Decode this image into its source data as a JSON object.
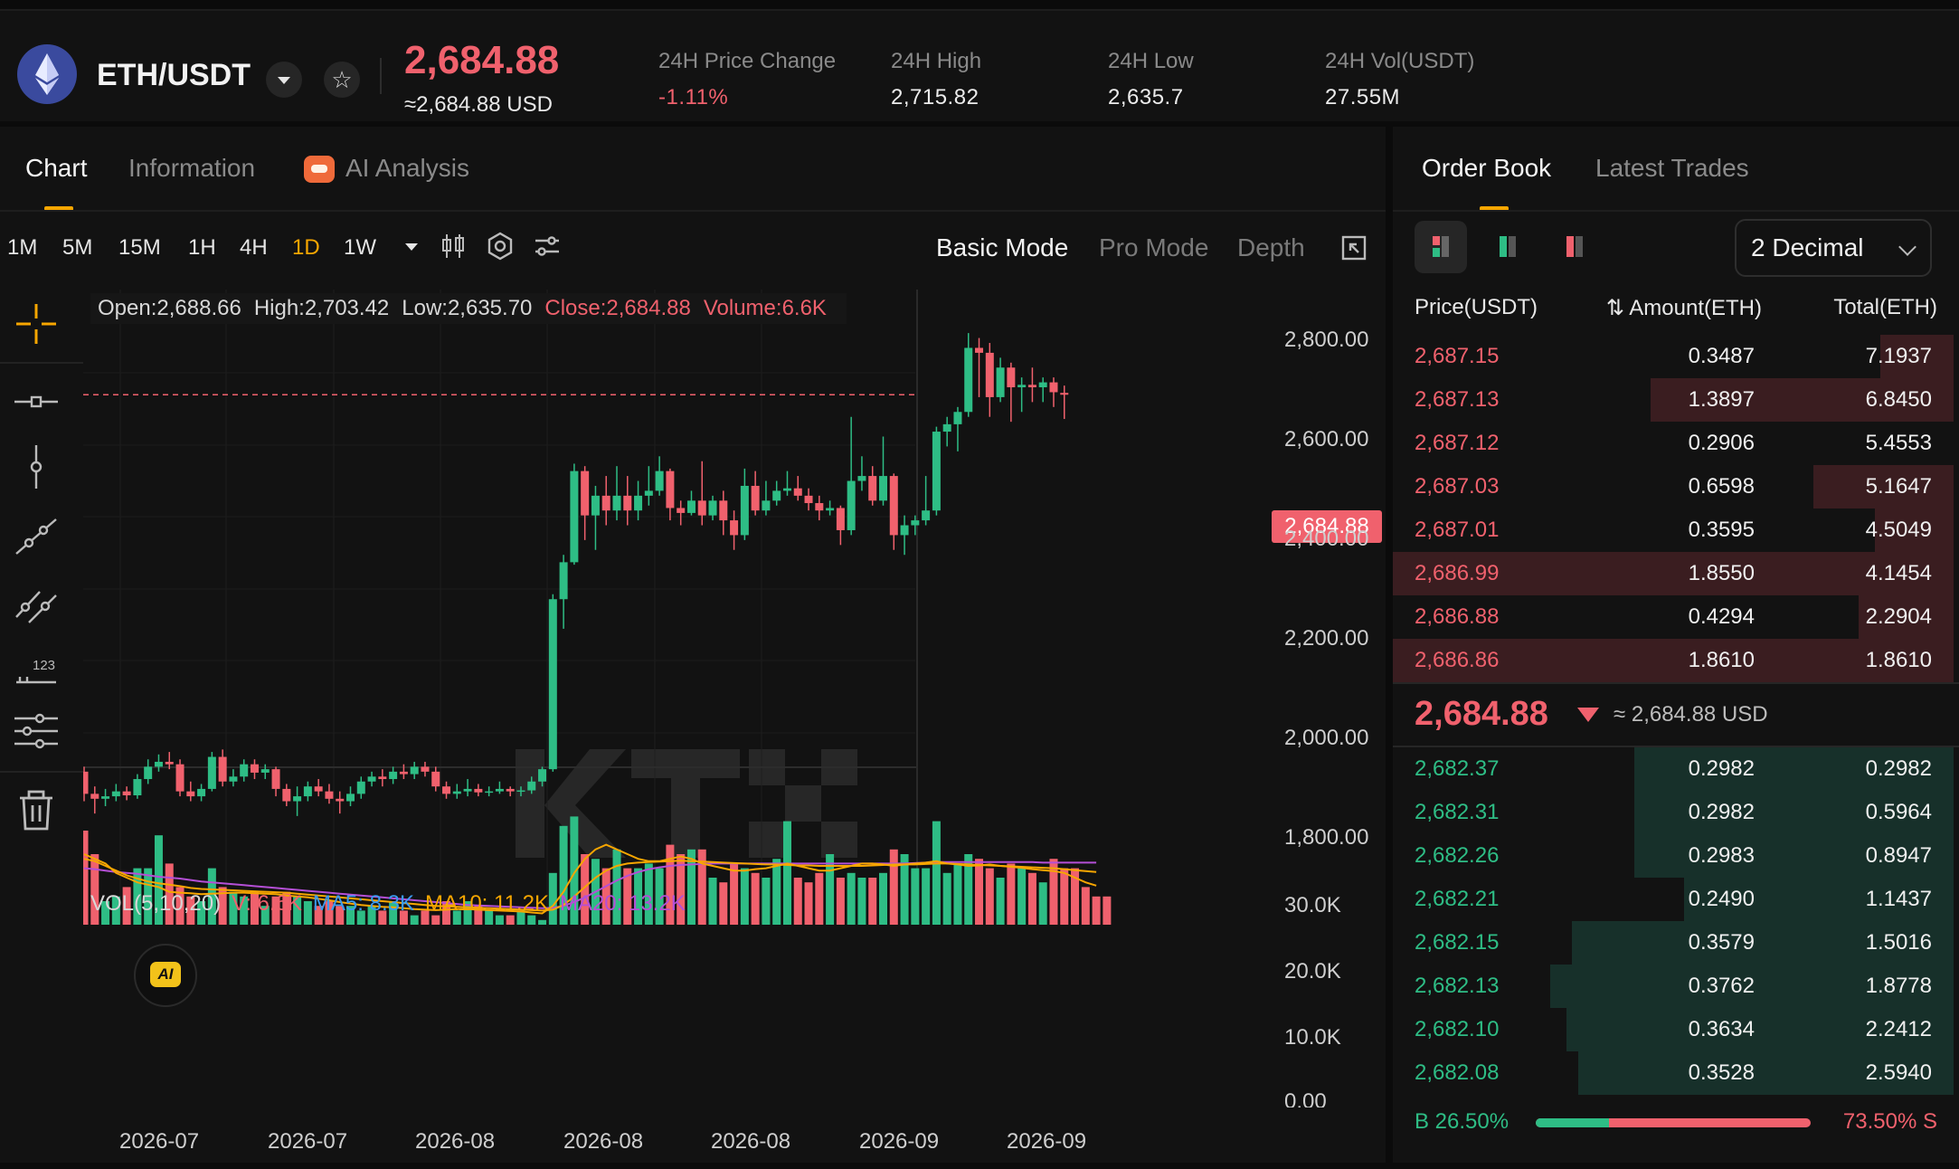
{
  "header": {
    "pair": "ETH/USDT",
    "last_price": "2,684.88",
    "last_price_usd": "≈2,684.88 USD",
    "stats": [
      {
        "label": "24H Price Change",
        "value": "-1.11%",
        "negative": true
      },
      {
        "label": "24H High",
        "value": "2,715.82"
      },
      {
        "label": "24H Low",
        "value": "2,635.7"
      },
      {
        "label": "24H Vol(USDT)",
        "value": "27.55M"
      }
    ]
  },
  "chart_tabs": [
    {
      "label": "Chart"
    },
    {
      "label": "Information"
    },
    {
      "label": "AI Analysis"
    }
  ],
  "intervals": [
    "1M",
    "5M",
    "15M",
    "1H",
    "4H",
    "1D",
    "1W"
  ],
  "active_interval": "1D",
  "modes": [
    "Basic Mode",
    "Pro Mode",
    "Depth"
  ],
  "ohlc": {
    "open": "Open:2,688.66",
    "high": "High:2,703.42",
    "low": "Low:2,635.70",
    "close": "Close:2,684.88",
    "volume": "Volume:6.6K"
  },
  "vol_legend": {
    "title": "VOL(5,10,20)",
    "v": "V: 6.6K",
    "ma5": "MA5: 8.3K",
    "ma10": "MA10: 11.2K",
    "ma20": "MA20: 13.2K"
  },
  "ai_badge": "AI",
  "current_price_tag": "2,684.88",
  "colors": {
    "up": "#2ebd85",
    "down": "#f0616d",
    "accent": "#f7a600",
    "ma5": "#f7a600",
    "ma10": "#f7a600",
    "ma20": "#b44fd6"
  },
  "chart_data": {
    "type": "candlestick",
    "price_axis": {
      "min": 1760,
      "max": 2880,
      "ticks": [
        "2,800.00",
        "2,600.00",
        "2,400.00",
        "2,200.00",
        "2,000.00",
        "1,800.00"
      ]
    },
    "volume_axis": {
      "min": 0,
      "max": 30000,
      "ticks": [
        "30.0K",
        "20.0K",
        "10.0K",
        "0.00"
      ]
    },
    "x_ticks": [
      "2026-07",
      "2026-07",
      "2026-08",
      "2026-08",
      "2026-08",
      "2026-09",
      "2026-09"
    ],
    "candles": [
      [
        1920,
        1875,
        1930,
        1860
      ],
      [
        1875,
        1865,
        1890,
        1835
      ],
      [
        1865,
        1870,
        1885,
        1850
      ],
      [
        1870,
        1880,
        1895,
        1860
      ],
      [
        1880,
        1872,
        1890,
        1862
      ],
      [
        1872,
        1905,
        1915,
        1865
      ],
      [
        1905,
        1930,
        1945,
        1895
      ],
      [
        1930,
        1940,
        1955,
        1920
      ],
      [
        1940,
        1935,
        1960,
        1925
      ],
      [
        1935,
        1880,
        1945,
        1870
      ],
      [
        1880,
        1870,
        1900,
        1860
      ],
      [
        1870,
        1885,
        1895,
        1860
      ],
      [
        1885,
        1950,
        1960,
        1880
      ],
      [
        1950,
        1900,
        1965,
        1890
      ],
      [
        1900,
        1910,
        1925,
        1890
      ],
      [
        1910,
        1935,
        1945,
        1900
      ],
      [
        1935,
        1918,
        1945,
        1905
      ],
      [
        1918,
        1925,
        1935,
        1905
      ],
      [
        1925,
        1885,
        1930,
        1870
      ],
      [
        1885,
        1860,
        1895,
        1850
      ],
      [
        1860,
        1870,
        1890,
        1830
      ],
      [
        1870,
        1890,
        1900,
        1860
      ],
      [
        1890,
        1880,
        1905,
        1870
      ],
      [
        1880,
        1865,
        1895,
        1855
      ],
      [
        1865,
        1860,
        1880,
        1835
      ],
      [
        1860,
        1875,
        1890,
        1850
      ],
      [
        1875,
        1900,
        1910,
        1865
      ],
      [
        1900,
        1910,
        1920,
        1890
      ],
      [
        1910,
        1905,
        1925,
        1890
      ],
      [
        1905,
        1920,
        1930,
        1895
      ],
      [
        1920,
        1915,
        1935,
        1905
      ],
      [
        1915,
        1930,
        1940,
        1905
      ],
      [
        1930,
        1920,
        1940,
        1910
      ],
      [
        1920,
        1890,
        1930,
        1880
      ],
      [
        1890,
        1875,
        1900,
        1865
      ],
      [
        1875,
        1880,
        1895,
        1865
      ],
      [
        1880,
        1885,
        1905,
        1870
      ],
      [
        1885,
        1878,
        1895,
        1870
      ],
      [
        1878,
        1880,
        1890,
        1870
      ],
      [
        1880,
        1885,
        1900,
        1875
      ],
      [
        1885,
        1880,
        1890,
        1870
      ],
      [
        1880,
        1882,
        1890,
        1870
      ],
      [
        1882,
        1900,
        1910,
        1875
      ],
      [
        1900,
        1925,
        1930,
        1890
      ],
      [
        1925,
        2270,
        2280,
        1920
      ],
      [
        2270,
        2345,
        2360,
        2210
      ],
      [
        2345,
        2530,
        2545,
        2340
      ],
      [
        2530,
        2440,
        2540,
        2390
      ],
      [
        2440,
        2480,
        2500,
        2370
      ],
      [
        2480,
        2450,
        2520,
        2420
      ],
      [
        2450,
        2480,
        2540,
        2430
      ],
      [
        2480,
        2450,
        2520,
        2420
      ],
      [
        2450,
        2480,
        2510,
        2430
      ],
      [
        2480,
        2490,
        2540,
        2460
      ],
      [
        2490,
        2530,
        2560,
        2480
      ],
      [
        2530,
        2455,
        2535,
        2430
      ],
      [
        2455,
        2445,
        2470,
        2420
      ],
      [
        2445,
        2470,
        2490,
        2440
      ],
      [
        2470,
        2440,
        2550,
        2420
      ],
      [
        2440,
        2470,
        2480,
        2430
      ],
      [
        2470,
        2430,
        2490,
        2400
      ],
      [
        2430,
        2400,
        2450,
        2370
      ],
      [
        2400,
        2500,
        2535,
        2390
      ],
      [
        2500,
        2450,
        2530,
        2440
      ],
      [
        2450,
        2470,
        2510,
        2440
      ],
      [
        2470,
        2490,
        2510,
        2460
      ],
      [
        2490,
        2495,
        2530,
        2480
      ],
      [
        2495,
        2480,
        2520,
        2470
      ],
      [
        2480,
        2465,
        2495,
        2450
      ],
      [
        2465,
        2450,
        2480,
        2430
      ],
      [
        2450,
        2455,
        2470,
        2440
      ],
      [
        2455,
        2410,
        2460,
        2380
      ],
      [
        2410,
        2510,
        2640,
        2400
      ],
      [
        2510,
        2520,
        2560,
        2490
      ],
      [
        2520,
        2470,
        2540,
        2460
      ],
      [
        2470,
        2520,
        2600,
        2460
      ],
      [
        2520,
        2400,
        2525,
        2370
      ],
      [
        2400,
        2420,
        2440,
        2360
      ],
      [
        2420,
        2430,
        2440,
        2400
      ],
      [
        2430,
        2450,
        2520,
        2420
      ],
      [
        2450,
        2610,
        2620,
        2440
      ],
      [
        2610,
        2625,
        2640,
        2580
      ],
      [
        2625,
        2650,
        2660,
        2570
      ],
      [
        2650,
        2780,
        2810,
        2640
      ],
      [
        2780,
        2770,
        2800,
        2680
      ],
      [
        2770,
        2680,
        2790,
        2640
      ],
      [
        2680,
        2740,
        2760,
        2670
      ],
      [
        2740,
        2700,
        2750,
        2630
      ],
      [
        2700,
        2705,
        2720,
        2650
      ],
      [
        2705,
        2700,
        2740,
        2670
      ],
      [
        2700,
        2710,
        2720,
        2670
      ],
      [
        2710,
        2690,
        2720,
        2660
      ],
      [
        2688.66,
        2684.88,
        2703.42,
        2635.7
      ]
    ],
    "volume": [
      20000,
      15000,
      5000,
      6000,
      8000,
      12000,
      12000,
      19000,
      13000,
      8000,
      6000,
      5000,
      12000,
      8000,
      7000,
      6000,
      7000,
      4000,
      6000,
      7000,
      6000,
      5000,
      4000,
      5000,
      4000,
      4000,
      3000,
      4000,
      3000,
      5000,
      3000,
      2000,
      3000,
      2000,
      5000,
      3000,
      5000,
      4000,
      3000,
      2000,
      2000,
      3000,
      2000,
      1000,
      11000,
      21000,
      23000,
      15000,
      14000,
      12000,
      16000,
      12000,
      12000,
      13000,
      12000,
      17000,
      15000,
      16000,
      16000,
      10000,
      9000,
      13000,
      12000,
      11000,
      10000,
      14000,
      22000,
      10000,
      9000,
      11000,
      15000,
      10000,
      11000,
      10000,
      10000,
      11000,
      16000,
      15000,
      12000,
      12000,
      22000,
      11000,
      13000,
      15000,
      14000,
      12000,
      10000,
      13000,
      12000,
      11000,
      9000,
      14000,
      12000,
      12000,
      8000,
      6000,
      6000
    ],
    "ma5": [
      15000,
      14000,
      13000,
      11000,
      10000,
      9000,
      8500,
      8000,
      7000,
      6800,
      6700,
      6500,
      6600,
      6700,
      6800,
      6800,
      6700,
      6600,
      6500,
      6200,
      6000,
      5800,
      5500,
      5200,
      4800,
      4500,
      4200,
      4000,
      3800,
      3700,
      3500,
      3300,
      3200,
      3100,
      3200,
      3300,
      3300,
      3200,
      3100,
      3000,
      2900,
      2800,
      2600,
      2400,
      4000,
      7000,
      11000,
      14000,
      16000,
      17000,
      16000,
      15000,
      14000,
      13500,
      13500,
      14000,
      14500,
      14000,
      13000,
      12500,
      12000,
      11500,
      11500,
      11800,
      12000,
      12500,
      13000,
      12500,
      12000,
      11500,
      11500,
      12000,
      12500,
      13000,
      13000,
      12800,
      12500,
      12800,
      13000,
      13200,
      13500,
      13000,
      12800,
      12500,
      12600,
      12800,
      12500,
      12300,
      12100,
      11800,
      11600,
      11400,
      11000,
      10000,
      9000,
      8300
    ],
    "ma10": [
      14000,
      13500,
      12500,
      11500,
      10500,
      9800,
      9200,
      8800,
      8500,
      8200,
      7800,
      7600,
      7500,
      7400,
      7300,
      7200,
      7100,
      7000,
      6900,
      6800,
      6600,
      6400,
      6200,
      6000,
      5800,
      5600,
      5400,
      5200,
      5000,
      4800,
      4600,
      4400,
      4200,
      4000,
      3900,
      3800,
      3700,
      3600,
      3500,
      3400,
      3300,
      3200,
      3100,
      3000,
      3200,
      4200,
      6000,
      8000,
      10000,
      11500,
      12500,
      13000,
      13200,
      13300,
      13400,
      13500,
      13600,
      13500,
      13400,
      13300,
      13200,
      13100,
      13000,
      12900,
      12800,
      12800,
      12700,
      12600,
      12600,
      12500,
      12500,
      12500,
      12500,
      12500,
      12600,
      12700,
      12800,
      12800,
      12800,
      12900,
      13000,
      13000,
      12900,
      12800,
      12700,
      12600,
      12500,
      12400,
      12300,
      12200,
      12100,
      12000,
      11800,
      11600,
      11400,
      11200
    ],
    "ma20": [
      12000,
      11800,
      11500,
      11200,
      11000,
      10800,
      10500,
      10200,
      10000,
      9800,
      9500,
      9200,
      9000,
      8800,
      8600,
      8400,
      8200,
      8000,
      7800,
      7600,
      7400,
      7200,
      7000,
      6800,
      6600,
      6400,
      6200,
      6000,
      5800,
      5600,
      5400,
      5200,
      5000,
      4800,
      4600,
      4400,
      4200,
      4100,
      4000,
      3900,
      3800,
      3700,
      3600,
      3500,
      3600,
      4000,
      4800,
      5800,
      7000,
      8200,
      9400,
      10400,
      11200,
      11800,
      12200,
      12500,
      12700,
      12800,
      12900,
      13000,
      13000,
      13000,
      13000,
      13000,
      13000,
      13000,
      13000,
      13000,
      13000,
      13000,
      13000,
      13000,
      13000,
      13000,
      13000,
      13000,
      13000,
      13000,
      13100,
      13200,
      13300,
      13300,
      13300,
      13300,
      13300,
      13300,
      13300,
      13300,
      13300,
      13300,
      13200,
      13200,
      13200,
      13200,
      13200,
      13200
    ]
  },
  "orderbook": {
    "tabs": [
      "Order Book",
      "Latest Trades"
    ],
    "decimal": "2 Decimal",
    "headers": {
      "price": "Price(USDT)",
      "amount": "⇅ Amount(ETH)",
      "total": "Total(ETH)"
    },
    "asks": [
      {
        "price": "2,687.15",
        "amount": "0.3487",
        "total": "7.1937",
        "depth": 0.13
      },
      {
        "price": "2,687.13",
        "amount": "1.3897",
        "total": "6.8450",
        "depth": 0.54
      },
      {
        "price": "2,687.12",
        "amount": "0.2906",
        "total": "5.4553",
        "depth": 0.0
      },
      {
        "price": "2,687.03",
        "amount": "0.6598",
        "total": "5.1647",
        "depth": 0.25
      },
      {
        "price": "2,687.01",
        "amount": "0.3595",
        "total": "4.5049",
        "depth": 0.14
      },
      {
        "price": "2,686.99",
        "amount": "1.8550",
        "total": "4.1454",
        "depth": 1.0
      },
      {
        "price": "2,686.88",
        "amount": "0.4294",
        "total": "2.2904",
        "depth": 0.17
      },
      {
        "price": "2,686.86",
        "amount": "1.8610",
        "total": "1.8610",
        "depth": 1.0
      }
    ],
    "mid_price": "2,684.88",
    "mid_usd": "≈ 2,684.88 USD",
    "bids": [
      {
        "price": "2,682.37",
        "amount": "0.2982",
        "total": "0.2982",
        "depth": 0.57
      },
      {
        "price": "2,682.31",
        "amount": "0.2982",
        "total": "0.5964",
        "depth": 0.57
      },
      {
        "price": "2,682.26",
        "amount": "0.2983",
        "total": "0.8947",
        "depth": 0.57
      },
      {
        "price": "2,682.21",
        "amount": "0.2490",
        "total": "1.1437",
        "depth": 0.48
      },
      {
        "price": "2,682.15",
        "amount": "0.3579",
        "total": "1.5016",
        "depth": 0.68
      },
      {
        "price": "2,682.13",
        "amount": "0.3762",
        "total": "1.8778",
        "depth": 0.72
      },
      {
        "price": "2,682.10",
        "amount": "0.3634",
        "total": "2.2412",
        "depth": 0.69
      },
      {
        "price": "2,682.08",
        "amount": "0.3528",
        "total": "2.5940",
        "depth": 0.67
      }
    ],
    "buy_ratio": 0.265,
    "buy_label": "B 26.50%",
    "sell_label": "73.50% S"
  }
}
